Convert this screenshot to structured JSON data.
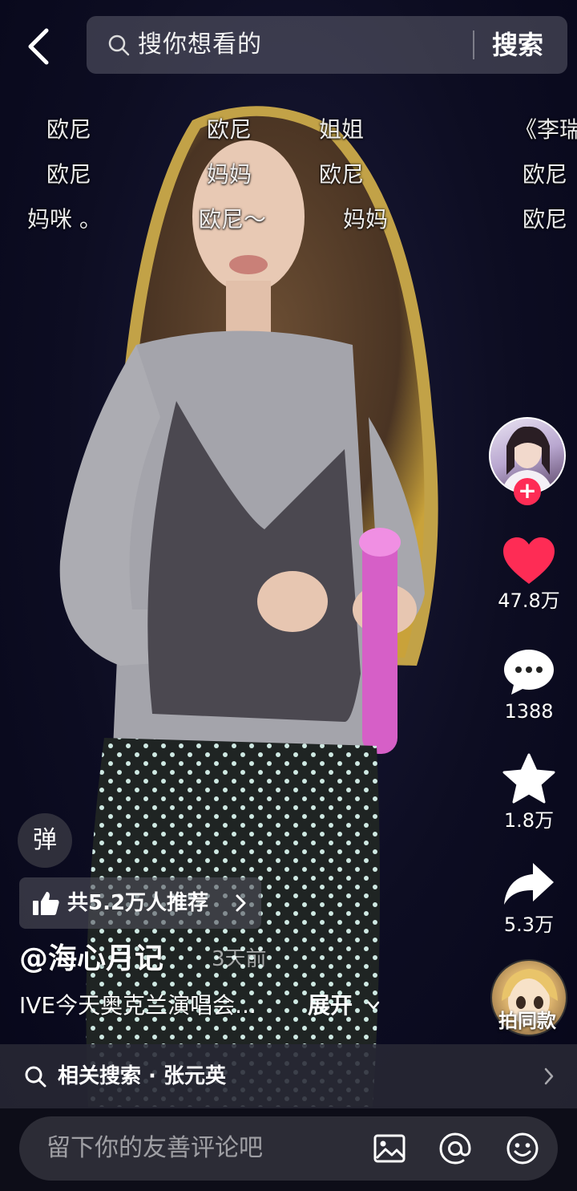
{
  "header": {
    "search_placeholder": "搜你想看的",
    "search_button": "搜索"
  },
  "danmaku": [
    {
      "text": "欧尼"
    },
    {
      "text": "欧尼"
    },
    {
      "text": "姐姐"
    },
    {
      "text": "《李瑞"
    },
    {
      "text": "欧尼"
    },
    {
      "text": "妈妈"
    },
    {
      "text": "欧尼"
    },
    {
      "text": "欧尼"
    },
    {
      "text": "妈咪 。"
    },
    {
      "text": "欧尼～"
    },
    {
      "text": "妈妈"
    },
    {
      "text": "欧尼"
    }
  ],
  "rail": {
    "like_count": "47.8万",
    "comment_count": "1388",
    "favorite_count": "1.8万",
    "share_count": "5.3万",
    "follow_symbol": "+",
    "music_label": "拍同款"
  },
  "info": {
    "danmaku_toggle": "弹",
    "recommend": "共5.2万人推荐",
    "author": "@海心月记",
    "time": "3天前",
    "caption": "IVE今天奥克兰演唱会...",
    "expand": "展开"
  },
  "related_search": {
    "text": "相关搜索 · 张元英"
  },
  "comment_bar": {
    "placeholder": "留下你的友善评论吧"
  },
  "colors": {
    "accent_red": "#fe2c55",
    "background": "#0b0b1c"
  }
}
